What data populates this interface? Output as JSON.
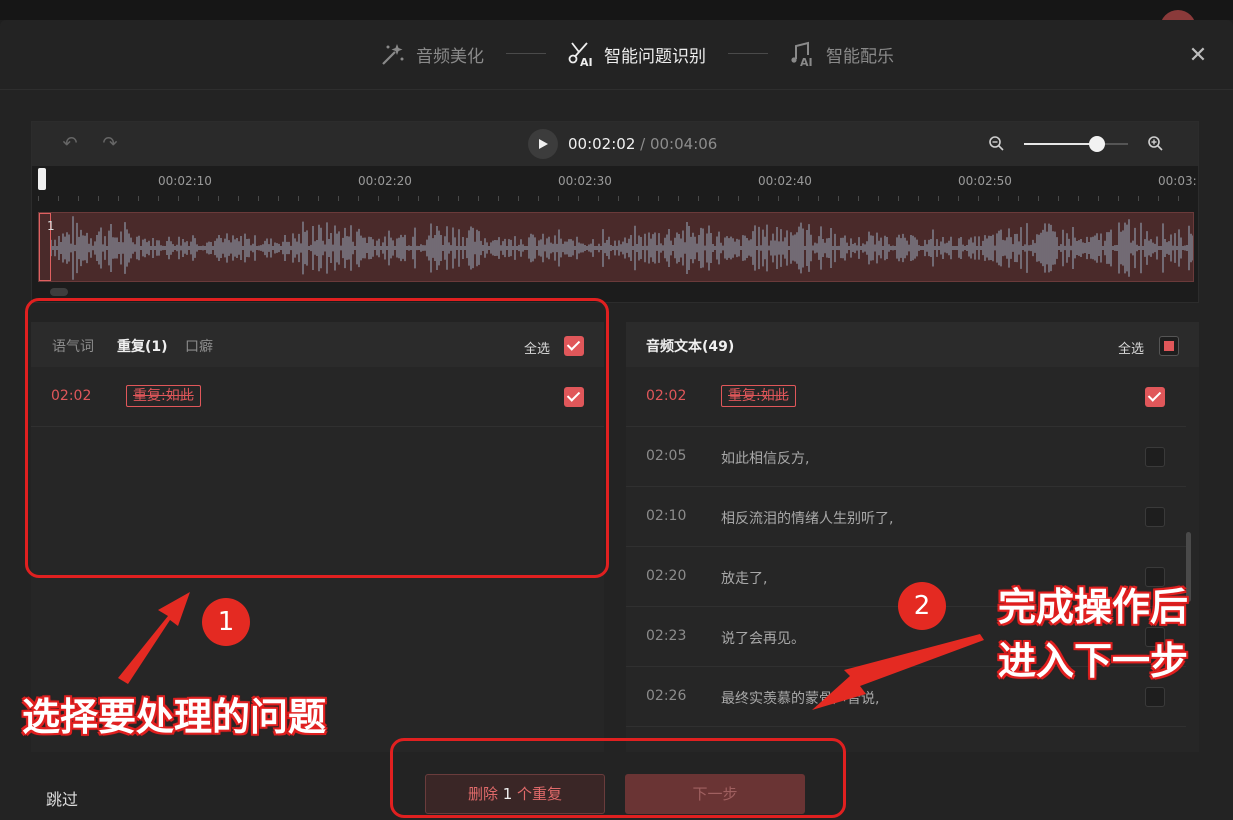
{
  "steps": [
    {
      "label": "音频美化",
      "icon": "magic-wand-icon",
      "active": false
    },
    {
      "label": "智能问题识别",
      "icon": "ai-scissors-icon",
      "active": true
    },
    {
      "label": "智能配乐",
      "icon": "ai-music-note-icon",
      "active": false
    }
  ],
  "player": {
    "current_time": "00:02:02",
    "separator": " / ",
    "total_time": "00:04:06",
    "zoom_level": 0.7,
    "ruler_labels": [
      "00:02:10",
      "00:02:20",
      "00:02:30",
      "00:02:40",
      "00:02:50",
      "00:03:"
    ],
    "clip_label": "1"
  },
  "issues_panel": {
    "tabs": [
      {
        "label": "语气词",
        "active": false
      },
      {
        "label": "重复(1)",
        "active": true
      },
      {
        "label": "口癖",
        "active": false
      }
    ],
    "select_all_label": "全选",
    "rows": [
      {
        "time": "02:02",
        "text": "重复:如此",
        "checked": true
      }
    ]
  },
  "transcript_panel": {
    "title": "音频文本(49)",
    "select_all_label": "全选",
    "rows": [
      {
        "time": "02:02",
        "text": "重复:如此",
        "flagged": true,
        "checked": true
      },
      {
        "time": "02:05",
        "text": "如此相信反方,",
        "flagged": false,
        "checked": false
      },
      {
        "time": "02:10",
        "text": "相反流泪的情绪人生别听了,",
        "flagged": false,
        "checked": false
      },
      {
        "time": "02:20",
        "text": "放走了,",
        "flagged": false,
        "checked": false
      },
      {
        "time": "02:23",
        "text": "说了会再见。",
        "flagged": false,
        "checked": false
      },
      {
        "time": "02:26",
        "text": "最终实羡慕的蒙骨声音说,",
        "flagged": false,
        "checked": false
      }
    ]
  },
  "footer": {
    "skip_label": "跳过",
    "delete_prefix": "删除 ",
    "delete_count": "1",
    "delete_suffix": " 个重复",
    "next_label": "下一步"
  },
  "annotations": {
    "marker_1": "1",
    "marker_2": "2",
    "text_1": "选择要处理的问题",
    "text_2_line1": "完成操作后",
    "text_2_line2": "进入下一步"
  },
  "colors": {
    "accent_red": "#e0575a",
    "annotation_red": "#e02020"
  }
}
